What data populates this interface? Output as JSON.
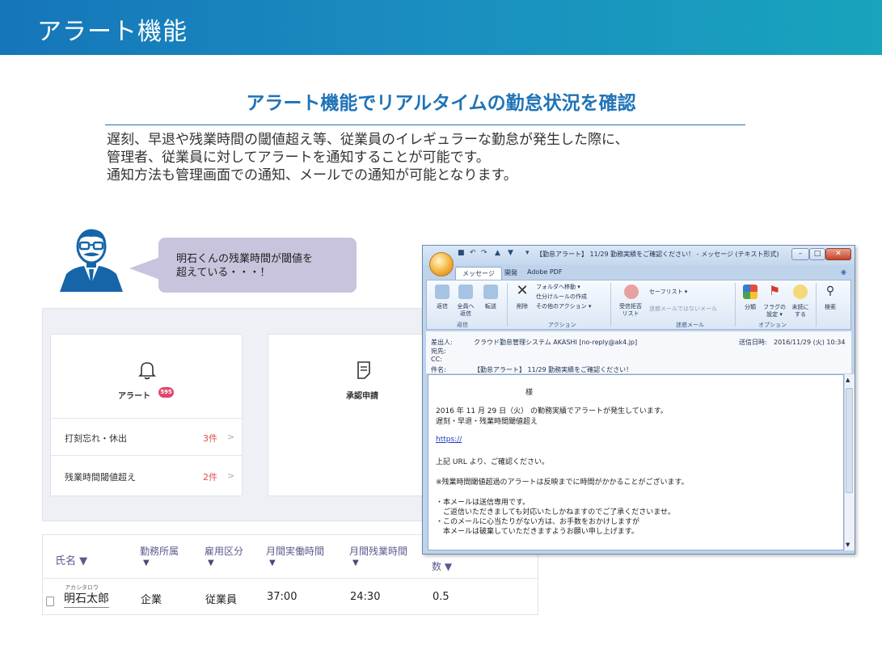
{
  "header": {
    "title": "アラート機能"
  },
  "headline": "アラート機能でリアルタイムの勤怠状況を確認",
  "description": [
    "遅刻、早退や残業時間の閾値超え等、従業員のイレギュラーな勤怠が発生した際に、",
    "管理者、従業員に対してアラートを通知することが可能です。",
    "通知方法も管理画面での通知、メールでの通知が可能となります。"
  ],
  "bubble": {
    "line1": "明石くんの残業時間が閾値を",
    "line2": "超えている・・・！"
  },
  "dashboard": {
    "alert_card": {
      "title": "アラート",
      "badge": "595",
      "rows": [
        {
          "label": "打刻忘れ・休出",
          "count": "3件",
          "chevron": ">"
        },
        {
          "label": "残業時間閾値超え",
          "count": "2件",
          "chevron": ">"
        }
      ]
    },
    "approval_card": {
      "title": "承認申請"
    }
  },
  "table": {
    "headers": [
      "氏名 ▼",
      "勤務所属",
      "雇用区分",
      "月間実働時間",
      "月間残業時間",
      "数 ▼"
    ],
    "row": {
      "furigana": "アカシタロウ",
      "name": "明石太郎",
      "dept": "企業",
      "type": "従業員",
      "work": "37:00",
      "overtime": "24:30",
      "count": "0.5"
    }
  },
  "email_window": {
    "title": "【勤怠アラート】 11/29 勤務実績をご確認ください！ - メッセージ (テキスト形式)",
    "tabs": [
      "メッセージ",
      "開発",
      "Adobe PDF"
    ],
    "ribbon": {
      "reply": "返信",
      "reply_all": "全員へ\n返信",
      "forward": "転送",
      "delete": "削除",
      "move_folder": "フォルダへ移動 ▾",
      "create_rule": "仕分けルールの作成",
      "other_actions": "その他のアクション ▾",
      "block": "受信拒否\nリスト",
      "safe_list": "セーフリスト ▾",
      "not_junk": "迷惑メールではないメール",
      "categorize": "分類",
      "flag": "フラグの\n設定 ▾",
      "mark_unread": "未読に\nする",
      "find": "検索",
      "group_reply": "返信",
      "group_action": "アクション",
      "group_junk": "迷惑メール",
      "group_options": "オプション"
    },
    "headers": {
      "from_label": "差出人:",
      "from_value": "クラウド勤怠管理システム AKASHI [no-reply@ak4.jp]",
      "sent_label": "送信日時:",
      "sent_value": "2016/11/29 (火) 10:34",
      "to_label": "宛先:",
      "cc_label": "CC:",
      "subject_label": "件名:",
      "subject_value": "【勤怠アラート】 11/29 勤務実績をご確認ください！"
    },
    "body": {
      "salutation": "様",
      "line1": "2016 年 11 月 29 日（火） の勤務実績でアラートが発生しています。",
      "line2": "遅刻・早退・残業時間閾値超え",
      "link": "https://",
      "line3": "上記 URL より、ご確認ください。",
      "line4": "※残業時間閾値超過のアラートは反映までに時間がかかることがございます。",
      "line5": "・本メールは送信専用です。",
      "line6": "　ご返信いただきましても対応いたしかねますのでご了承くださいませ。",
      "line7": "・このメールに心当たりがない方は、お手数をおかけしますが",
      "line8": "　本メールは破棄していただきますようお願い申し上げます。"
    }
  },
  "colors": {
    "header_band": "#1a8cc0",
    "headline": "#1f73b7",
    "badge": "#e0466d",
    "count": "#e44a4a",
    "bubble": "#c9c4dd"
  }
}
